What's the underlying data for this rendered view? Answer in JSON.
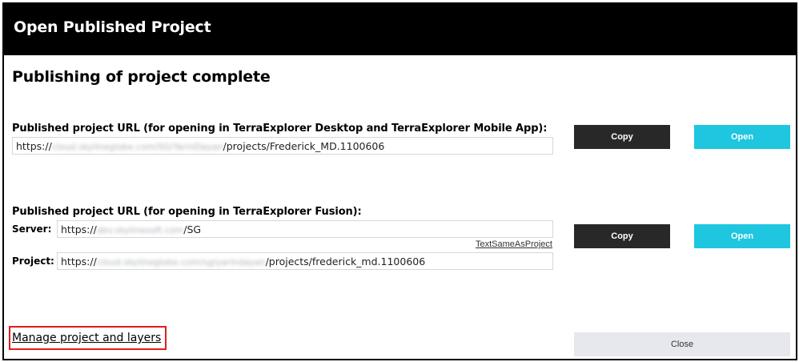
{
  "dialog": {
    "title": "Open Published Project",
    "heading": "Publishing of project complete"
  },
  "desktop_section": {
    "label": "Published project URL (for opening in TerraExplorer Desktop and TerraExplorer Mobile App):",
    "url_prefix": "https://",
    "url_redacted": "cloud.skylineglobe.com/SG/YarinDayan",
    "url_suffix": "/projects/Frederick_MD.1100606",
    "copy_label": "Copy",
    "open_label": "Open"
  },
  "fusion_section": {
    "label": "Published project URL (for opening in TerraExplorer Fusion):",
    "server_label": "Server:",
    "server_prefix": "https://",
    "server_redacted": "dev.skylinesoft.com",
    "server_suffix": "/SG",
    "text_same_link": "TextSameAsProject",
    "project_label": "Project:",
    "project_prefix": "https://",
    "project_redacted": "cloud.skylineglobe.com/sg/yarindayan",
    "project_suffix": "/projects/frederick_md.1100606",
    "copy_label": "Copy",
    "open_label": "Open"
  },
  "footer": {
    "manage_link": "Manage project and layers",
    "close_label": "Close"
  },
  "colors": {
    "titlebar_bg": "#000000",
    "copy_button": "#282828",
    "open_button": "#1ec6e0",
    "close_button": "#e7e8ee",
    "highlight_box": "#e11d1d"
  }
}
